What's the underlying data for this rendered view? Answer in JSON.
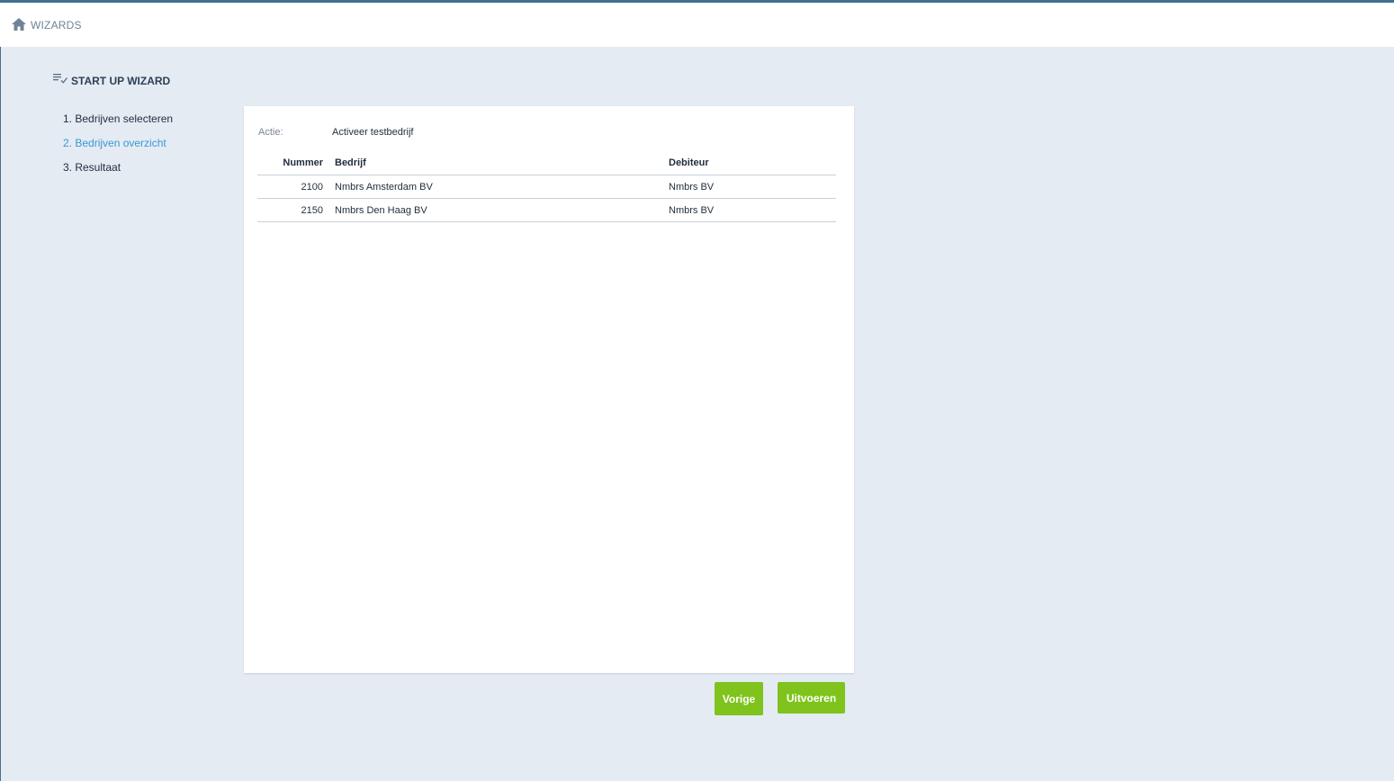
{
  "topbar": {
    "title": "WIZARDS",
    "home_icon": "home-icon"
  },
  "wizard": {
    "title": "START UP WIZARD",
    "icon": "checklist-icon"
  },
  "steps": [
    {
      "label": "1. Bedrijven selecteren",
      "active": false
    },
    {
      "label": "2. Bedrijven overzicht",
      "active": true
    },
    {
      "label": "3. Resultaat",
      "active": false
    }
  ],
  "panel": {
    "actie_label": "Actie:",
    "actie_value": "Activeer testbedrijf",
    "columns": [
      "Nummer",
      "Bedrijf",
      "Debiteur"
    ],
    "rows": [
      {
        "nummer": "2100",
        "bedrijf": "Nmbrs Amsterdam BV",
        "debiteur": "Nmbrs BV"
      },
      {
        "nummer": "2150",
        "bedrijf": "Nmbrs Den Haag BV",
        "debiteur": "Nmbrs BV"
      }
    ]
  },
  "buttons": {
    "previous_label": "Vorige",
    "execute_label": "Uitvoeren"
  },
  "colors": {
    "accent_green": "#7fc31c",
    "active_step": "#3a97d4",
    "top_border": "#3f6f93",
    "background": "#e4ebf3"
  }
}
